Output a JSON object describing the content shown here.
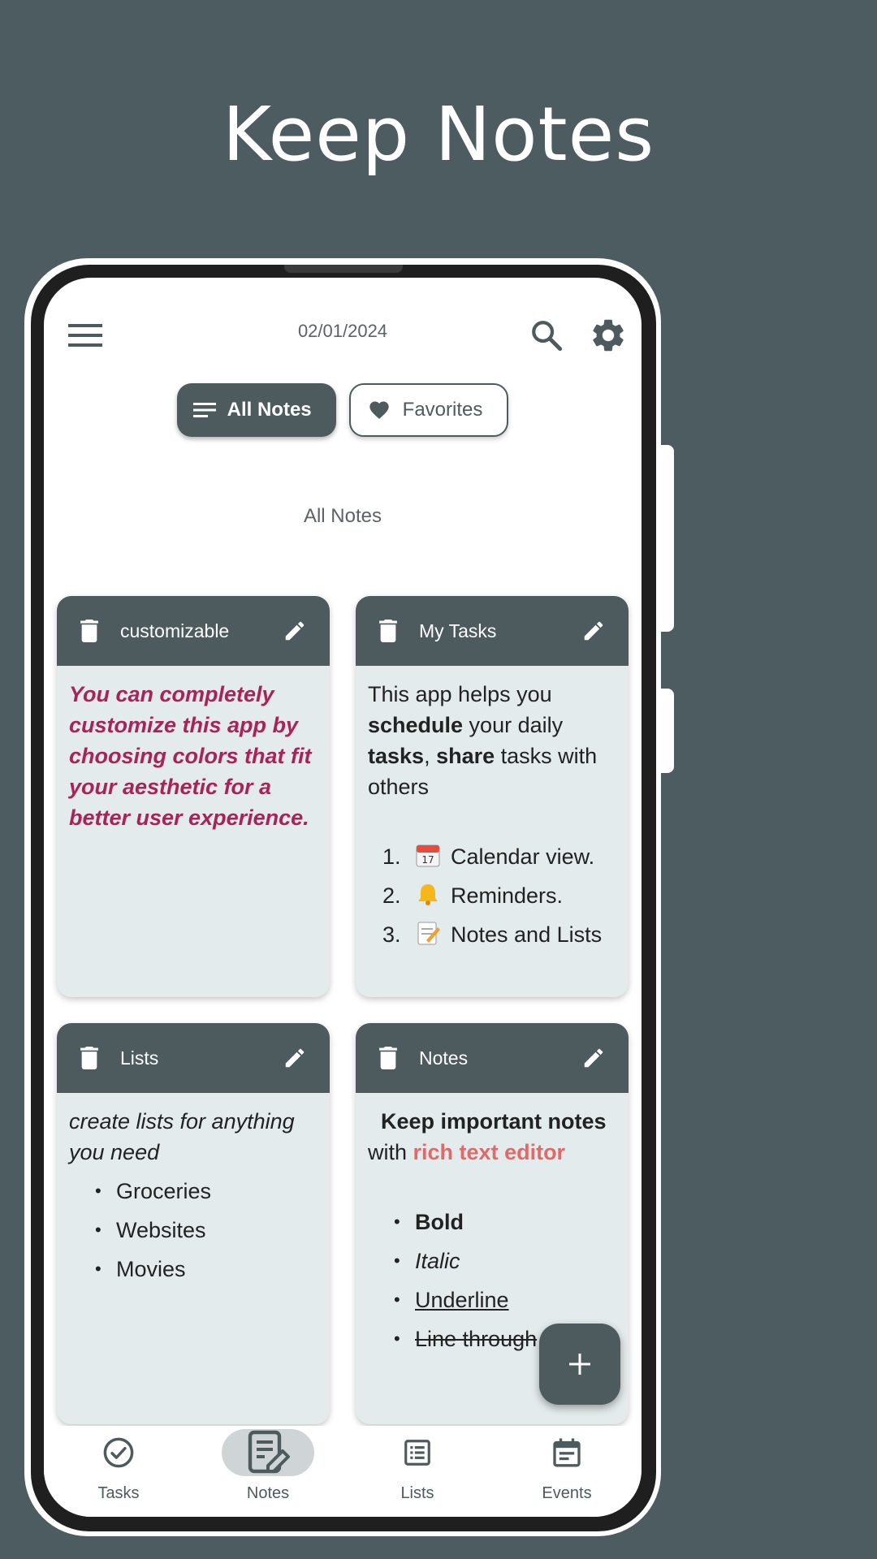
{
  "promo": {
    "title": "Keep Notes"
  },
  "topbar": {
    "date": "02/01/2024",
    "menu_icon": "menu-icon",
    "search_icon": "search-icon",
    "settings_icon": "gear-icon"
  },
  "filters": {
    "all_notes": {
      "label": "All Notes",
      "icon": "list-icon",
      "selected": true
    },
    "favorites": {
      "label": "Favorites",
      "icon": "heart-icon",
      "selected": false
    }
  },
  "section_title": "All Notes",
  "notes": [
    {
      "title": "customizable",
      "body": "You can completely customize this app by choosing colors that fit your aesthetic for a better user experience.",
      "color": "#a8235a"
    },
    {
      "title": "My Tasks",
      "intro": [
        "This app helps you ",
        "schedule",
        " your daily ",
        "tasks",
        ", ",
        "share",
        " tasks with others"
      ],
      "items": [
        {
          "num": "1.",
          "emoji": "calendar-emoji",
          "text": "Calendar view."
        },
        {
          "num": "2.",
          "emoji": "bell-emoji",
          "text": "Reminders."
        },
        {
          "num": "3.",
          "emoji": "memo-emoji",
          "text": "Notes and Lists"
        }
      ]
    },
    {
      "title": "Lists",
      "intro": "create lists for anything you need",
      "items": [
        "Groceries",
        "Websites",
        "Movies"
      ]
    },
    {
      "title": "Notes",
      "intro_bold": "Keep important notes",
      "intro_with": "with ",
      "intro_rich": "rich text editor",
      "items": [
        "Bold",
        "Italic",
        "Underline",
        "Line through"
      ],
      "accent": "#e06a6a"
    }
  ],
  "fab": {
    "icon": "plus-icon"
  },
  "bottom_nav": [
    {
      "label": "Tasks",
      "icon": "check-circle-icon",
      "active": false
    },
    {
      "label": "Notes",
      "icon": "note-edit-icon",
      "active": true
    },
    {
      "label": "Lists",
      "icon": "list-box-icon",
      "active": false
    },
    {
      "label": "Events",
      "icon": "calendar-icon",
      "active": false
    }
  ],
  "colors": {
    "background": "#4d5c60",
    "primary": "#4d5a5e",
    "card": "#e4ebec"
  }
}
